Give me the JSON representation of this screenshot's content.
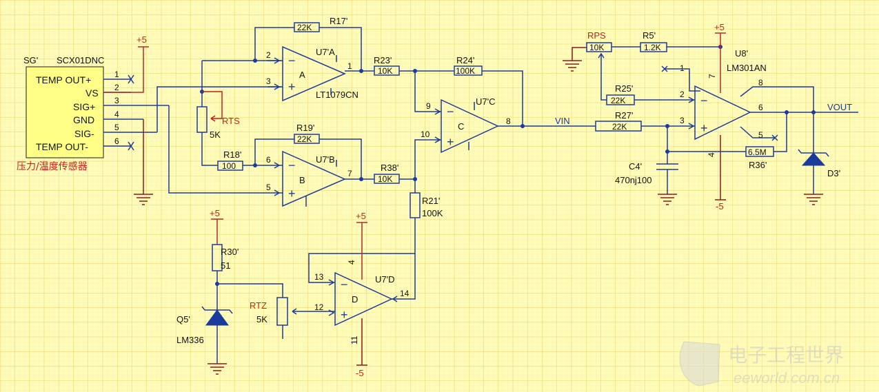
{
  "sensor": {
    "ref": "SG'",
    "part": "SCX01DNC",
    "caption": "压力/温度传感器",
    "pins": [
      {
        "name": "TEMP OUT+",
        "num": "1"
      },
      {
        "name": "VS",
        "num": "2"
      },
      {
        "name": "SIG+",
        "num": "3"
      },
      {
        "name": "GND",
        "num": "4"
      },
      {
        "name": "SIG-",
        "num": "5"
      },
      {
        "name": "TEMP OUT-",
        "num": "6"
      }
    ]
  },
  "power": {
    "pos": "+5",
    "neg": "-5"
  },
  "resistors": {
    "r17": {
      "ref": "R17'",
      "val": "22K"
    },
    "r23": {
      "ref": "R23'",
      "val": "10K"
    },
    "r24": {
      "ref": "R24'",
      "val": "100K"
    },
    "r18": {
      "ref": "R18'",
      "val": "100"
    },
    "r19": {
      "ref": "R19'",
      "val": "22K"
    },
    "r38": {
      "ref": "R38'",
      "val": "10K"
    },
    "r21": {
      "ref": "R21'",
      "val": "100K"
    },
    "r30": {
      "ref": "R30'",
      "val": "51"
    },
    "r5": {
      "ref": "R5'",
      "val": "1.2K"
    },
    "r25": {
      "ref": "R25'",
      "val": "22K"
    },
    "r27": {
      "ref": "R27'",
      "val": "22K"
    },
    "r36": {
      "ref": "R36'",
      "val": "6.5M"
    }
  },
  "pots": {
    "rts": {
      "ref": "RTS",
      "val": "5K"
    },
    "rtz": {
      "ref": "RTZ",
      "val": "5K"
    },
    "rps": {
      "ref": "RPS",
      "val": "10K"
    }
  },
  "opamps": {
    "a": {
      "ref": "U7'A",
      "unit": "A",
      "part": "LT1079CN",
      "pins": {
        "inv": "2",
        "noninv": "3",
        "out": "1"
      }
    },
    "b": {
      "ref": "U7'B",
      "unit": "B",
      "pins": {
        "inv": "6",
        "noninv": "5",
        "out": "7"
      }
    },
    "c": {
      "ref": "U7'C",
      "unit": "C",
      "pins": {
        "inv": "9",
        "noninv": "10",
        "out": "8"
      }
    },
    "d": {
      "ref": "U7'D",
      "unit": "D",
      "pins": {
        "inv": "13",
        "noninv": "12",
        "out": "14",
        "vpos": "4",
        "vneg": "11"
      }
    },
    "u8": {
      "ref": "U8'",
      "part": "LM301AN",
      "pins": {
        "p1": "1",
        "inv": "2",
        "noninv": "3",
        "p4": "4",
        "p5": "5",
        "out": "6",
        "p7": "7",
        "p8": "8"
      }
    }
  },
  "cap": {
    "ref": "C4'",
    "val": "470nj100"
  },
  "diodes": {
    "q5": {
      "ref": "Q5'",
      "part": "LM336"
    },
    "d3": {
      "ref": "D3'"
    }
  },
  "nets": {
    "vin": "VIN",
    "vout": "VOUT"
  },
  "watermark": {
    "cn": "电子工程世界",
    "en": "eeworld.com.cn"
  }
}
